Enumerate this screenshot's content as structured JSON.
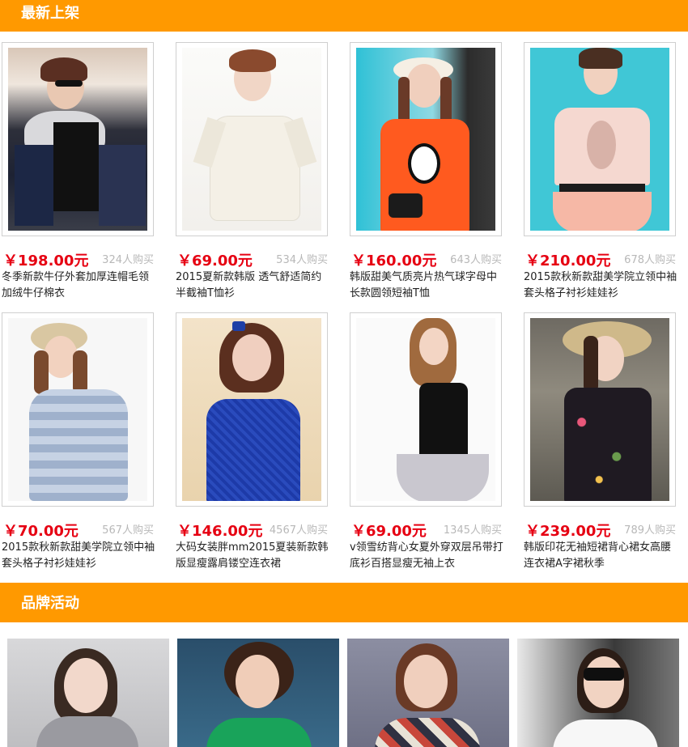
{
  "sections": {
    "new_arrivals": "最新上架",
    "brand_activity": "品牌活动"
  },
  "products": [
    {
      "price": "￥198.00元",
      "sold": "324人购买",
      "title": "冬季新款牛仔外套加厚连帽毛领加绒牛仔棉衣"
    },
    {
      "price": "￥69.00元",
      "sold": "534人购买",
      "title": "2015夏新款韩版 透气舒适简约半截袖T恤衫"
    },
    {
      "price": "￥160.00元",
      "sold": "643人购买",
      "title": "韩版甜美气质亮片热气球字母中长款圆领短袖T恤"
    },
    {
      "price": "￥210.00元",
      "sold": "678人购买",
      "title": "2015款秋新款甜美学院立领中袖套头格子衬衫娃娃衫"
    },
    {
      "price": "￥70.00元",
      "sold": "567人购买",
      "title": "2015款秋新款甜美学院立领中袖套头格子衬衫娃娃衫"
    },
    {
      "price": "￥146.00元",
      "sold": "4567人购买",
      "title": "大码女装胖mm2015夏装新款韩版显瘦露肩镂空连衣裙"
    },
    {
      "price": "￥69.00元",
      "sold": "1345人购买",
      "title": "v领雪纺背心女夏外穿双层吊带打底衫百搭显瘦无袖上衣"
    },
    {
      "price": "￥239.00元",
      "sold": "789人购买",
      "title": "韩版印花无袖短裙背心裙女高腰连衣裙A字裙秋季"
    }
  ],
  "colors": {
    "accent": "#ff9900",
    "price": "#e60012",
    "muted": "#b8b8b8"
  }
}
